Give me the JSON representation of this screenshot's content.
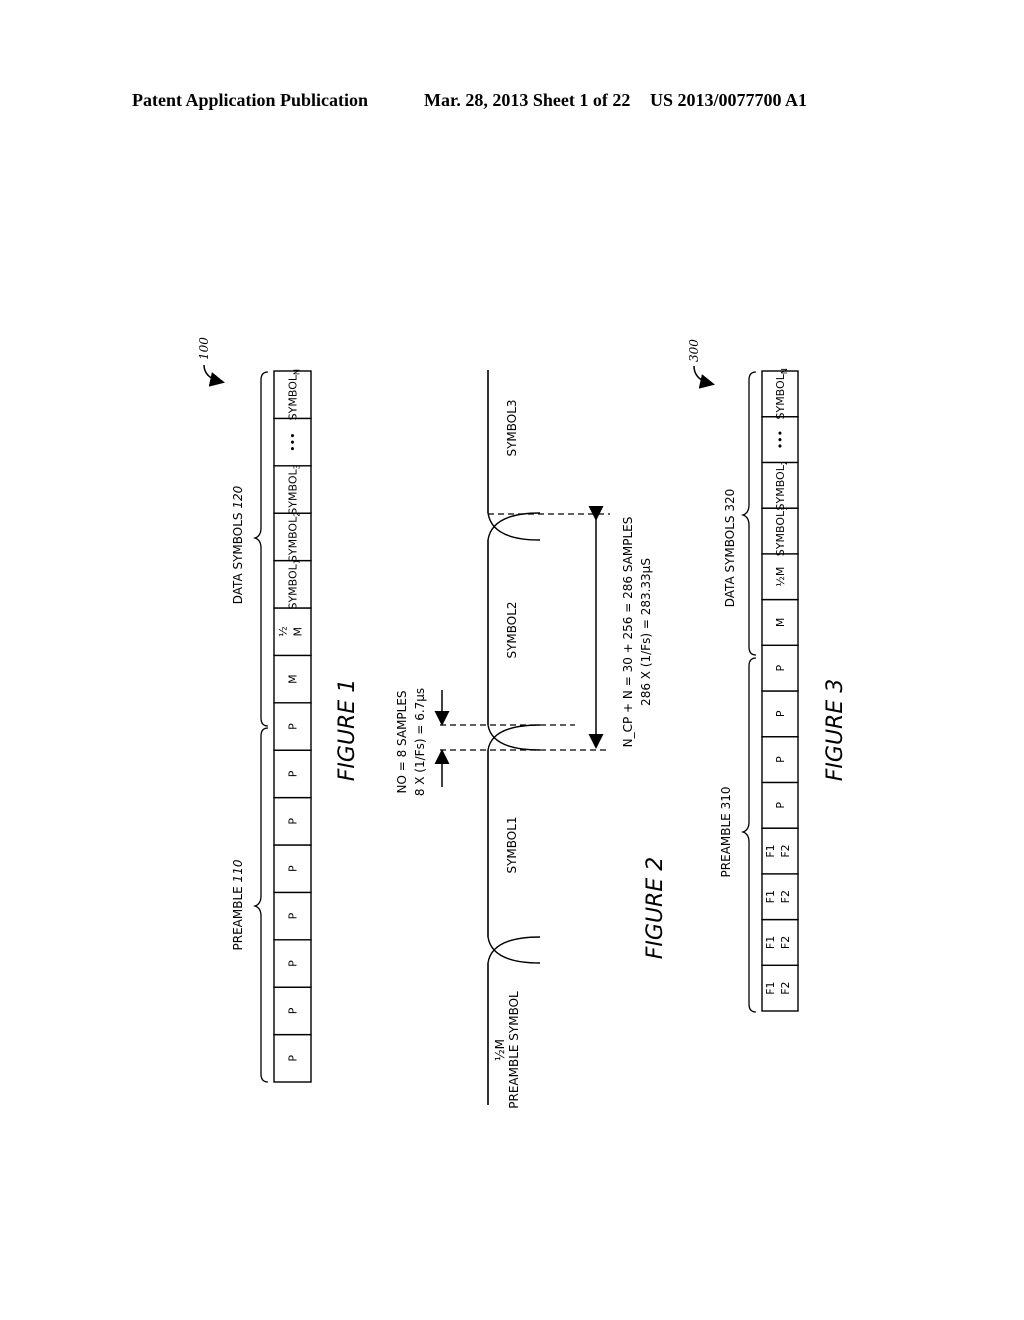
{
  "header": {
    "left": "Patent Application Publication",
    "middle": "Mar. 28, 2013  Sheet 1 of 22",
    "right": "US 2013/0077700 A1"
  },
  "figure1": {
    "ref_numeral": "100",
    "caption": "FIGURE 1",
    "preamble_label": "PREAMBLE",
    "preamble_ref": "110",
    "data_label": "DATA SYMBOLS",
    "data_ref": "120",
    "cells": [
      "P",
      "P",
      "P",
      "P",
      "P",
      "P",
      "P",
      "P",
      "M",
      "½ M",
      "SYMBOL1",
      "SYMBOL2",
      "SYMBOL3",
      "•••",
      "SYMBOLN"
    ]
  },
  "figure2": {
    "caption": "FIGURE 2",
    "preamble_symbol_line1": "½M",
    "preamble_symbol_line2": "PREAMBLE SYMBOL",
    "symbol1": "SYMBOL1",
    "symbol2": "SYMBOL2",
    "symbol3": "SYMBOL3",
    "overlap_line1": "NO = 8 SAMPLES",
    "overlap_line2": "8 X (1/Fs) = 6.7µs",
    "length_line1": "N_CP + N = 30 + 256 = 286 SAMPLES",
    "length_line2": "286 X (1/Fs) = 283.33µS"
  },
  "figure3": {
    "ref_numeral": "300",
    "caption": "FIGURE 3",
    "preamble_label": "PREAMBLE 310",
    "data_label": "DATA SYMBOLS 320",
    "cells": [
      "F1 F2",
      "F1 F2",
      "F1 F2",
      "F1 F2",
      "P",
      "P",
      "P",
      "P",
      "M",
      "½M",
      "SYMBOL1",
      "SYMBOL2",
      "•••",
      "SYMBOLN"
    ]
  }
}
